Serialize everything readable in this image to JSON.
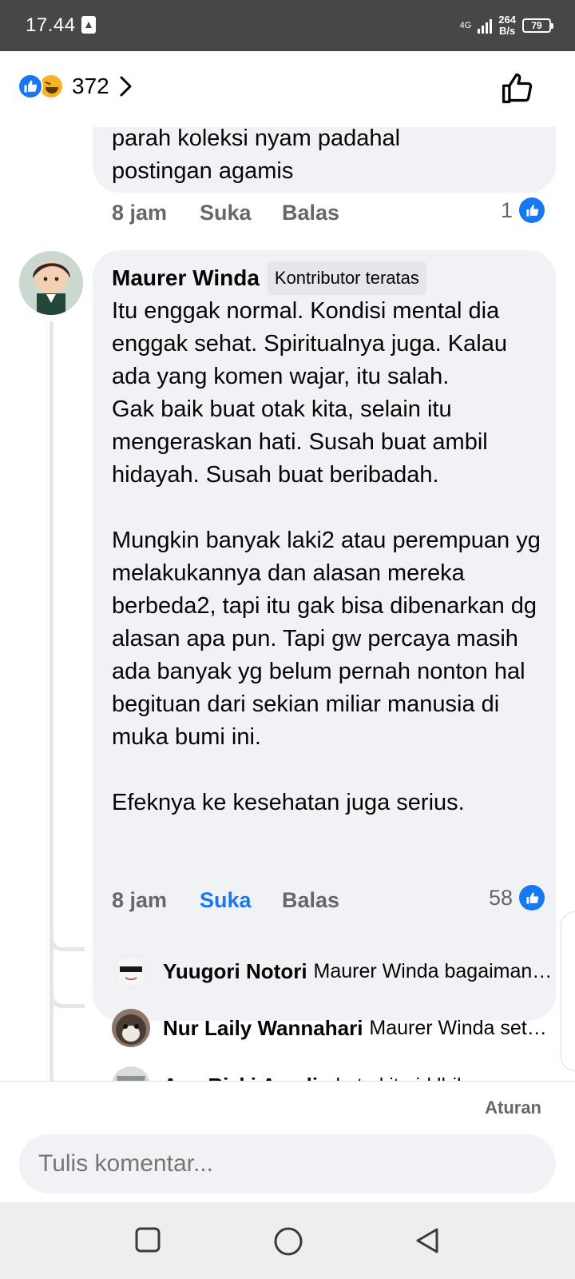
{
  "status_bar": {
    "time": "17.44",
    "network": "4G",
    "speed_value": "264",
    "speed_unit": "B/s",
    "battery": "79"
  },
  "header": {
    "reaction_icons": [
      "like-icon",
      "haha-icon"
    ],
    "reaction_count": "372"
  },
  "previous_comment": {
    "text_lines": [
      "parah koleksi nyam padahal",
      "postingan agamis"
    ],
    "time": "8 jam",
    "like_label": "Suka",
    "reply_label": "Balas",
    "likes": "1"
  },
  "comment": {
    "author": "Maurer Winda",
    "badge": "Kontributor teratas",
    "paragraph_1": "Itu enggak normal. Kondisi mental dia enggak sehat. Spiritualnya juga. Kalau ada yang komen wajar, itu salah.",
    "paragraph_2": "Gak baik buat otak kita, selain itu mengeraskan hati. Susah buat ambil hidayah. Susah buat beribadah.",
    "paragraph_3": "Mungkin banyak laki2 atau perempuan yg melakukannya dan alasan mereka berbeda2, tapi itu gak bisa dibenarkan dg alasan apa pun. Tapi gw percaya masih ada banyak yg belum pernah nonton hal begituan dari sekian miliar manusia di muka bumi ini.",
    "paragraph_4": "Efeknya ke kesehatan juga serius.",
    "time": "8 jam",
    "like_label": "Suka",
    "reply_label": "Balas",
    "likes": "58",
    "accent_color": "#1877f2"
  },
  "replies": [
    {
      "name": "Yuugori Notori",
      "text": "Maurer Winda bagaiman…"
    },
    {
      "name": "Nur Laily Wannahari",
      "text": "Maurer Winda set…"
    },
    {
      "name": "Aan Rizki Amalia",
      "text": "kata kita jd lbih…"
    }
  ],
  "footer": {
    "rules_label": "Aturan",
    "comment_placeholder": "Tulis komentar..."
  },
  "navigation": [
    "square-icon",
    "circle-icon",
    "back-triangle-icon"
  ]
}
